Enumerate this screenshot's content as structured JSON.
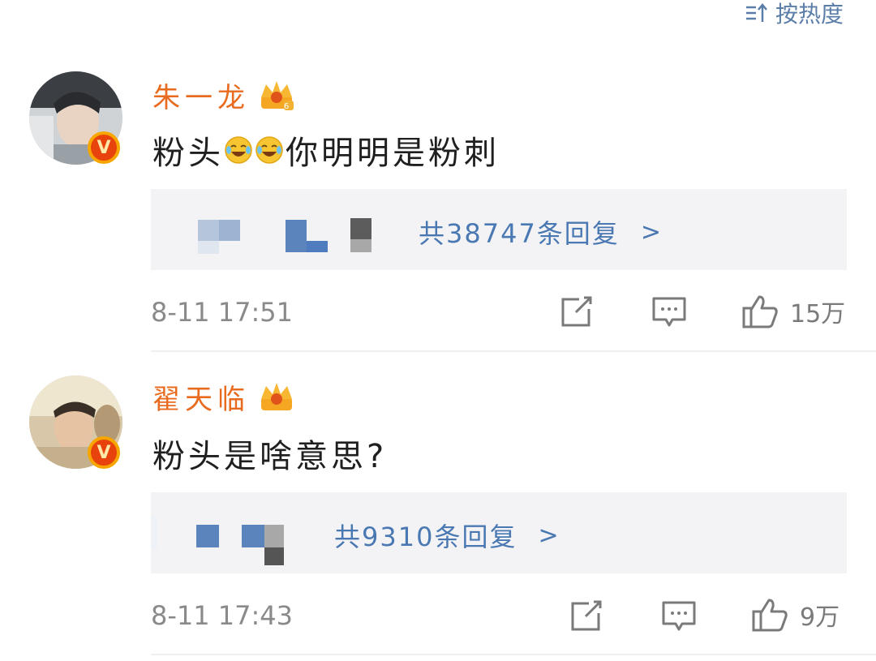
{
  "sort": {
    "label": "按热度",
    "icon": "sort-icon"
  },
  "comments": [
    {
      "username": "朱一龙",
      "verified_badge": "V",
      "text_prefix": "粉头",
      "text_suffix": "你明明是粉刺",
      "emoji": "laughing-crying-emoji",
      "reply_count": "共38747条回复",
      "reply_chevron": ">",
      "time": "8-11 17:51",
      "likes": "15万"
    },
    {
      "username": "翟天临",
      "verified_badge": "V",
      "text": "粉头是啥意思?",
      "reply_count": "共9310条回复",
      "reply_chevron": ">",
      "time": "8-11 17:43",
      "likes": "9万"
    }
  ],
  "colors": {
    "username": "#e86b1f",
    "link": "#4a78b3",
    "meta": "#8a8a8a",
    "reply_bg": "#f3f3f5"
  }
}
